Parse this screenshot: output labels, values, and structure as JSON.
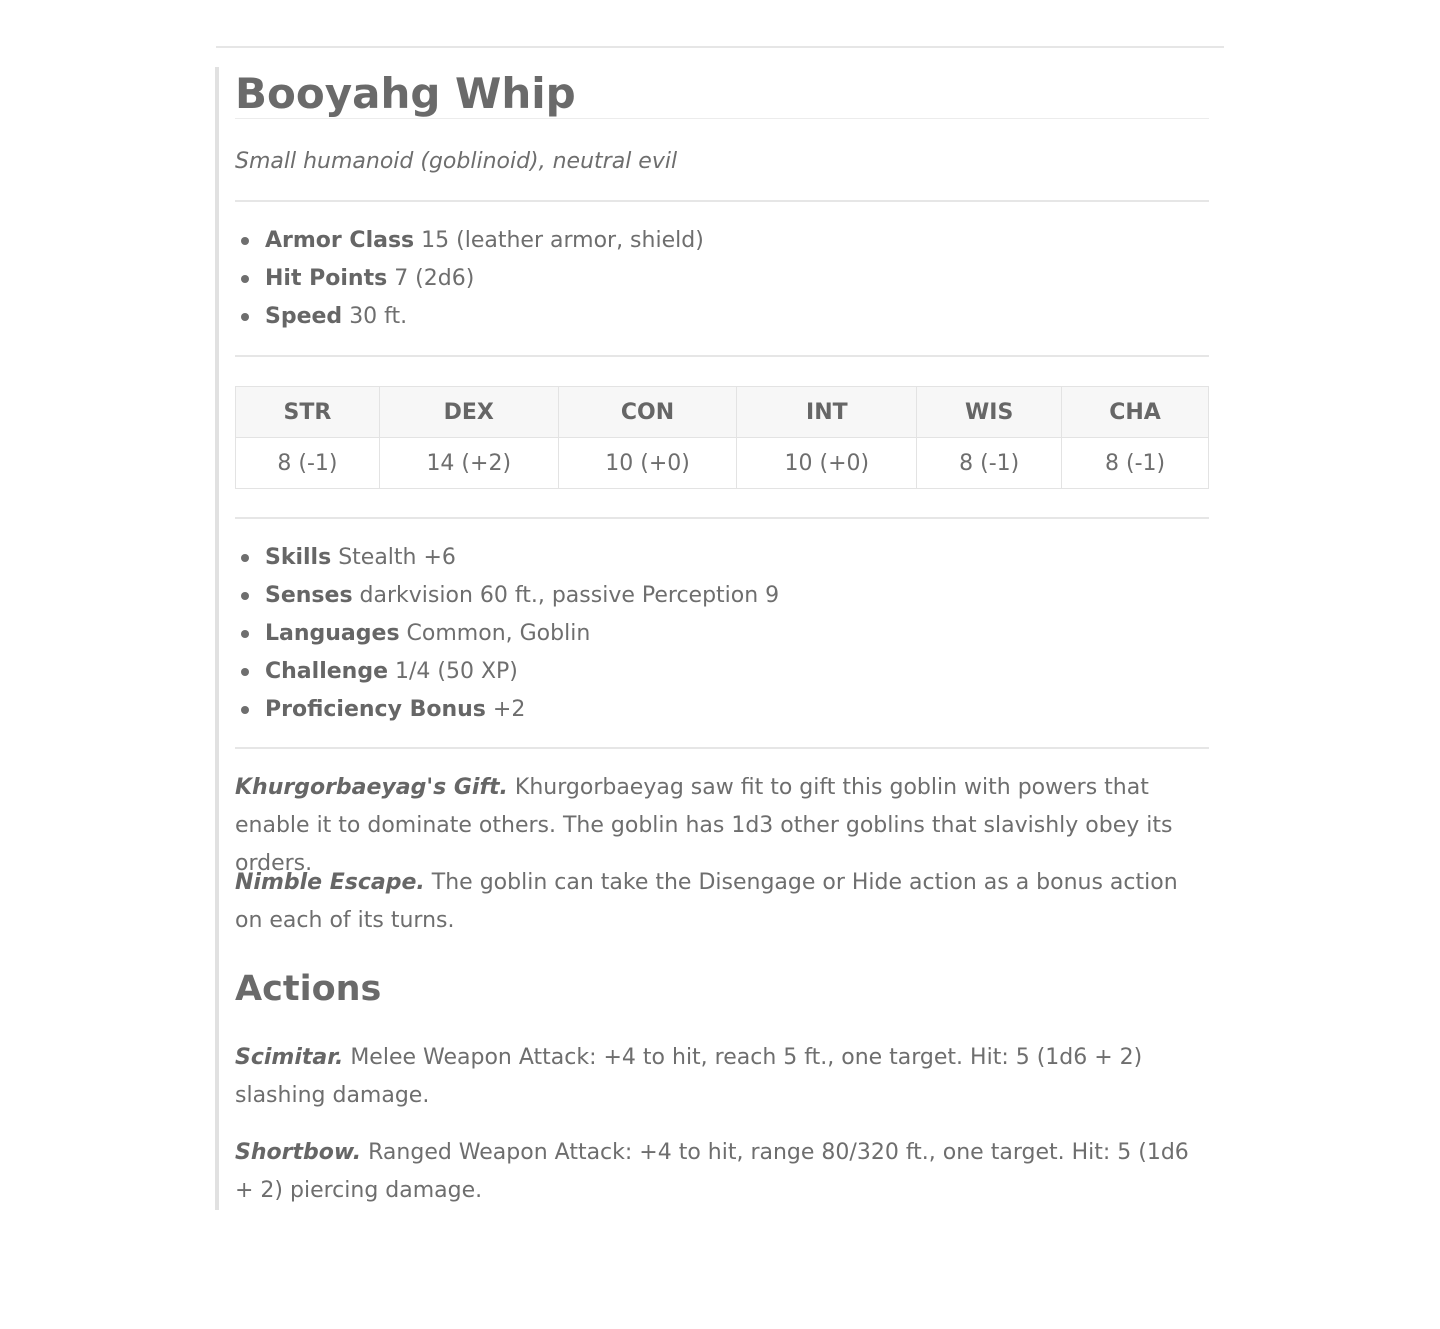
{
  "monster": {
    "name": "Booyahg Whip",
    "type_line": "Small humanoid (goblinoid), neutral evil"
  },
  "core_stats": [
    {
      "label": "Armor Class",
      "value": "15 (leather armor, shield)"
    },
    {
      "label": "Hit Points",
      "value": "7 (2d6)"
    },
    {
      "label": "Speed",
      "value": "30 ft."
    }
  ],
  "abilities": {
    "headers": [
      "STR",
      "DEX",
      "CON",
      "INT",
      "WIS",
      "CHA"
    ],
    "values": [
      "8 (-1)",
      "14 (+2)",
      "10 (+0)",
      "10 (+0)",
      "8 (-1)",
      "8 (-1)"
    ]
  },
  "secondary_stats": [
    {
      "label": "Skills",
      "value": "Stealth +6"
    },
    {
      "label": "Senses",
      "value": "darkvision 60 ft., passive Perception 9"
    },
    {
      "label": "Languages",
      "value": "Common, Goblin"
    },
    {
      "label": "Challenge",
      "value": "1/4 (50 XP)"
    },
    {
      "label": "Proficiency Bonus",
      "value": "+2"
    }
  ],
  "traits": [
    {
      "name": "Khurgorbaeyag's Gift.",
      "text": "Khurgorbaeyag saw fit to gift this goblin with powers that enable it to dominate others. The goblin has 1d3 other goblins that slavishly obey its orders."
    },
    {
      "name": "Nimble Escape.",
      "text": "The goblin can take the Disengage or Hide action as a bonus action on each of its turns."
    }
  ],
  "actions_heading": "Actions",
  "actions": [
    {
      "name": "Scimitar.",
      "text": "Melee Weapon Attack: +4 to hit, reach 5 ft., one target. Hit: 5 (1d6 + 2) slashing damage."
    },
    {
      "name": "Shortbow.",
      "text": "Ranged Weapon Attack: +4 to hit, range 80/320 ft., one target. Hit: 5 (1d6 + 2) piercing damage."
    }
  ]
}
